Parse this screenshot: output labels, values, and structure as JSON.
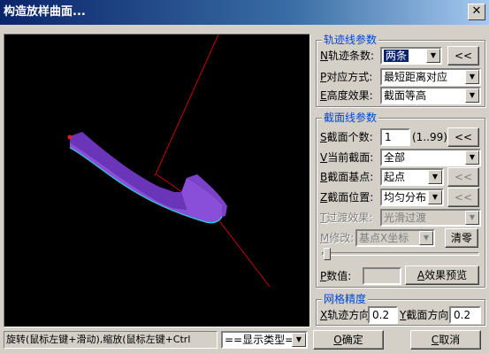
{
  "window": {
    "title": "构造放样曲面...",
    "close_glyph": "✕"
  },
  "trajectory": {
    "group_title": "轨迹线参数",
    "count_hot": "N",
    "count_label": "轨迹条数:",
    "count_value": "两条",
    "count_button": "<<",
    "match_hot": "P",
    "match_label": "对应方式:",
    "match_value": "最短距离对应",
    "height_hot": "E",
    "height_label": "高度效果:",
    "height_value": "截面等高"
  },
  "section": {
    "group_title": "截面线参数",
    "count_hot": "S",
    "count_label": "截面个数:",
    "count_value": "1",
    "count_range": "(1..99)",
    "count_button": "<<",
    "current_hot": "V",
    "current_label": "当前截面:",
    "current_value": "全部",
    "base_hot": "B",
    "base_label": "截面基点:",
    "base_value": "起点",
    "base_button": "<<",
    "position_hot": "Z",
    "position_label": "截面位置:",
    "position_value": "均匀分布",
    "position_button": "<<",
    "transition_hot": "T",
    "transition_label": "过渡效果:",
    "transition_value": "光滑过渡",
    "modify_hot": "M",
    "modify_label": "修改:",
    "modify_value": "基点X坐标",
    "reset_button": "清零",
    "param_hot": "P",
    "param_label": "数值:",
    "param_value": "",
    "preview_hot": "A",
    "preview_label": "效果预览"
  },
  "mesh": {
    "group_title": "网格精度",
    "traj_hot": "X",
    "traj_label": "轨迹方向",
    "traj_value": "0.2",
    "sect_hot": "Y",
    "sect_label": "截面方向",
    "sect_value": "0.2"
  },
  "status": {
    "hint": "旋转(鼠标左键+滑动),缩放(鼠标左键+Ctrl",
    "display_type": "==显示类型=="
  },
  "buttons": {
    "ok_hot": "O",
    "ok_label": "确定",
    "cancel_hot": "C",
    "cancel_label": "取消"
  },
  "viewport": {
    "background": "#000000",
    "axis_color": "#cc0000",
    "surface_color": "#8a4fd8",
    "edge_color": "#2fd1e6"
  }
}
